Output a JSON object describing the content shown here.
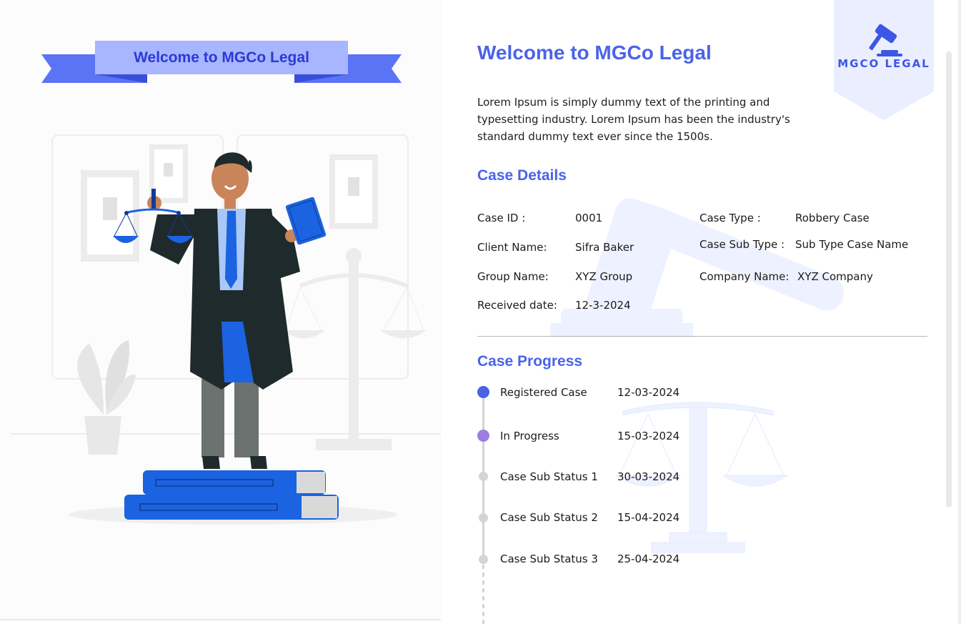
{
  "banner": {
    "title": "Welcome to MGCo Legal"
  },
  "logo": {
    "text": "MGCO LEGAL"
  },
  "header": {
    "title": "Welcome to MGCo Legal",
    "intro": "Lorem Ipsum is simply dummy text of the printing and typesetting industry. Lorem Ipsum has been the industry's standard dummy text ever since the 1500s."
  },
  "case_details": {
    "title": "Case Details",
    "case_id_label": "Case ID :",
    "case_id_value": "0001",
    "client_name_label": "Client Name:",
    "client_name_value": "Sifra Baker",
    "group_name_label": "Group Name:",
    "group_name_value": "XYZ Group",
    "received_date_label": "Received date:",
    "received_date_value": "12-3-2024",
    "case_type_label": "Case Type :",
    "case_type_value": "Robbery Case",
    "case_sub_type_label": "Case Sub Type :",
    "case_sub_type_value": "Sub Type Case Name",
    "company_name_label": "Company Name:",
    "company_name_value": "XYZ  Company"
  },
  "case_progress": {
    "title": "Case Progress",
    "steps": [
      {
        "label": "Registered Case",
        "date": "12-03-2024",
        "state": "completed"
      },
      {
        "label": "In Progress",
        "date": "15-03-2024",
        "state": "current"
      },
      {
        "label": "Case Sub Status 1",
        "date": "30-03-2024",
        "state": "pending"
      },
      {
        "label": "Case Sub Status 2",
        "date": "15-04-2024",
        "state": "pending"
      },
      {
        "label": "Case Sub Status 3",
        "date": "25-04-2024",
        "state": "pending"
      }
    ]
  },
  "colors": {
    "accent": "#4a63e8",
    "banner_fill": "#a8b5ff",
    "banner_ribbon": "#5b73f5",
    "dot_completed": "#4a63e8",
    "dot_current": "#9d7de0",
    "dot_pending": "#d4d4d4"
  },
  "icons": {
    "logo": "gavel-icon",
    "watermark_top": "gavel-icon",
    "watermark_bottom": "scales-icon"
  }
}
